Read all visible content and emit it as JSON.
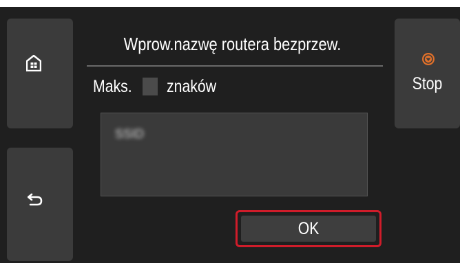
{
  "header": {
    "title": "Wprow.nazwę routera bezprzew."
  },
  "limit": {
    "prefix": "Maks.",
    "suffix": "znaków"
  },
  "input": {
    "value": "SSID"
  },
  "buttons": {
    "ok_label": "OK",
    "stop_label": "Stop"
  },
  "icons": {
    "home": "home-icon",
    "back": "back-arrow-icon",
    "stop": "stop-icon"
  },
  "colors": {
    "background": "#1f1f1f",
    "button": "#3b3b3b",
    "highlight": "#d01c2a",
    "stop_accent": "#e0702a"
  }
}
